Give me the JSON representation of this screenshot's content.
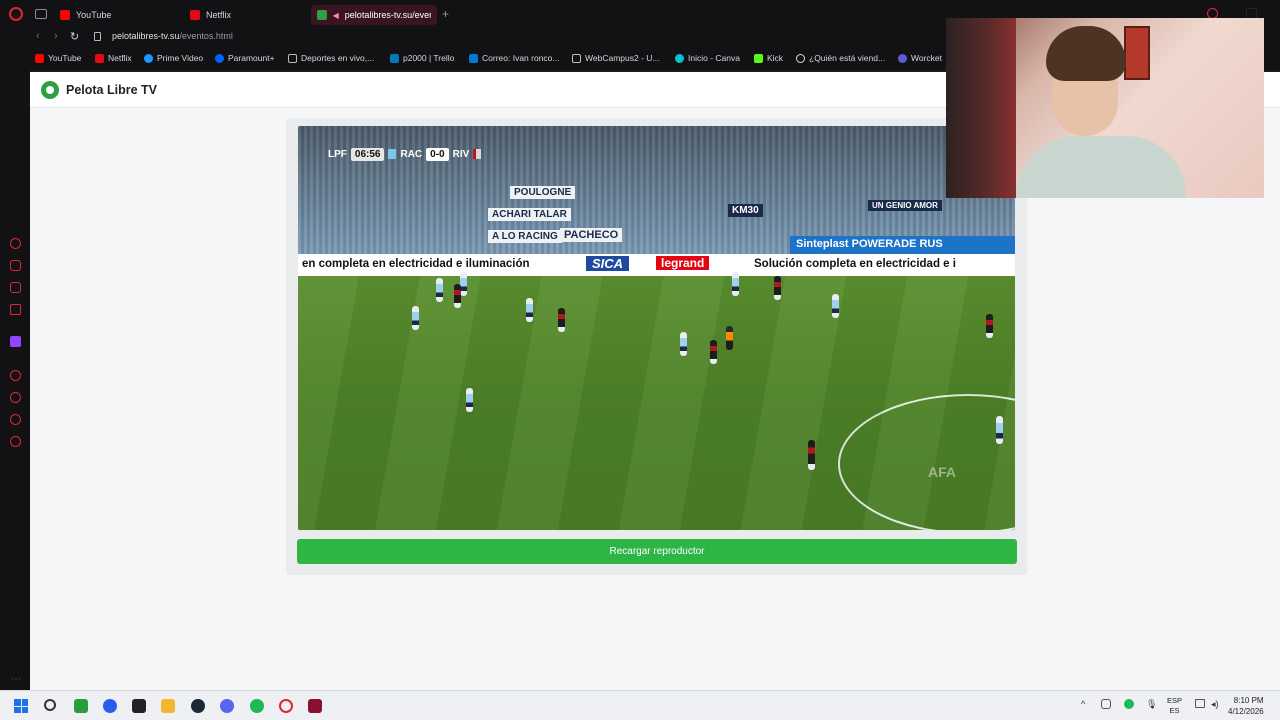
{
  "browser": {
    "tabs": [
      {
        "label": "YouTube",
        "color": "#ff0000"
      },
      {
        "label": "Netflix",
        "color": "#e50914"
      },
      {
        "label": "pelotalibres-tv.su/even",
        "color": "#2ea043",
        "active": true
      }
    ],
    "url_domain": "pelotalibres-tv.su",
    "url_path": "/eventos.html",
    "bookmarks": [
      {
        "label": "YouTube",
        "color": "#ff0000"
      },
      {
        "label": "Netflix",
        "color": "#e50914"
      },
      {
        "label": "Prime Video",
        "color": "#1a98ff"
      },
      {
        "label": "Paramount+",
        "color": "#0064ff"
      },
      {
        "label": "Deportes en vivo,...",
        "color": "#ffffff"
      },
      {
        "label": "p2000 | Trello",
        "color": "#0079bf"
      },
      {
        "label": "Correo: Ivan ronco...",
        "color": "#0078d4"
      },
      {
        "label": "WebCampus2 - U...",
        "color": "#ffffff"
      },
      {
        "label": "Inicio - Canva",
        "color": "#00c4cc"
      },
      {
        "label": "Kick",
        "color": "#53fc18"
      },
      {
        "label": "¿Quién está viend...",
        "color": "#ffffff"
      },
      {
        "label": "Worcket",
        "color": "#5b5bd6"
      }
    ]
  },
  "site": {
    "title": "Pelota Libre TV",
    "reload_button": "Recargar reproductor"
  },
  "video": {
    "scorebug": {
      "league": "LPF",
      "time": "06:56",
      "home": "RAC",
      "score": "0-0",
      "away": "RIV"
    },
    "ads": {
      "left_board": "en completa en electricidad e iluminación",
      "sica": "SICA",
      "legrand": "legrand",
      "right_board": "Solución completa en electricidad e i",
      "blue_board": "Sinteplast  POWERADE  RUS"
    },
    "banners": [
      "POULOGNE",
      "ACHARI TALAR",
      "A LO RACING",
      "PACHECO",
      "KM30",
      "UN GENIO AMOR"
    ],
    "watermark": "AFA"
  },
  "taskbar": {
    "language_top": "ESP",
    "language_bottom": "ES",
    "time": "8:10 PM",
    "date": "4/12/2026",
    "apps": [
      {
        "name": "search-icon",
        "color": "#333333"
      },
      {
        "name": "terminal-icon",
        "color": "#2a9d3a"
      },
      {
        "name": "ea-icon",
        "color": "#2b5ee8"
      },
      {
        "name": "capcut-icon",
        "color": "#222222"
      },
      {
        "name": "folder-icon",
        "color": "#f2b632"
      },
      {
        "name": "steam-icon",
        "color": "#1b2838"
      },
      {
        "name": "discord-icon",
        "color": "#5865f2"
      },
      {
        "name": "spotify-icon",
        "color": "#1db954"
      },
      {
        "name": "opera-icon",
        "color": "#e02634"
      },
      {
        "name": "opera-gx-icon",
        "color": "#8a1030"
      }
    ]
  }
}
